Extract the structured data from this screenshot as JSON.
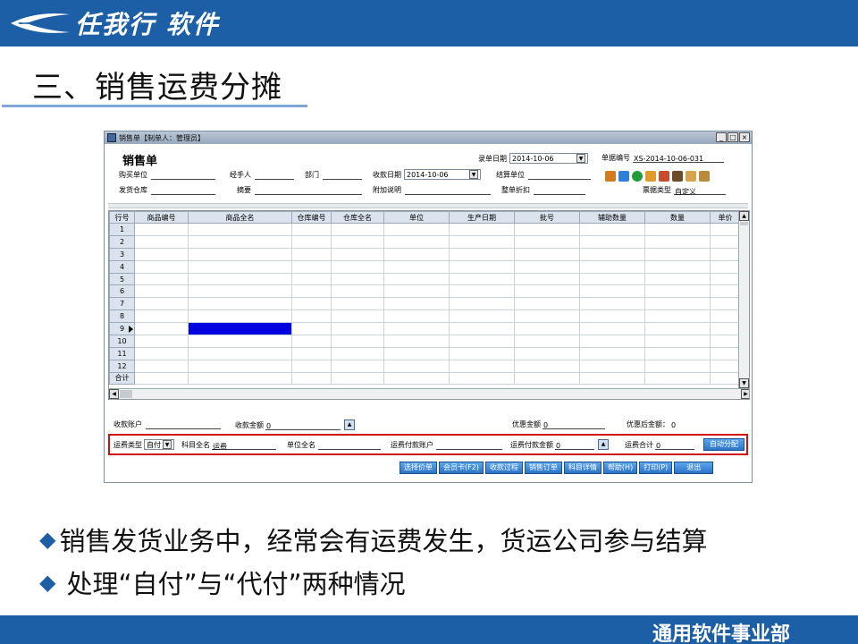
{
  "slide": {
    "logo_text": "任我行 软件",
    "title": "三、销售运费分摊",
    "bullets": [
      "销售发货业务中，经常会有运费发生，货运公司参与结算",
      "处理“自付”与“代付”两种情况"
    ],
    "footer": "通用软件事业部",
    "brand_color": "#1d5fa6"
  },
  "window": {
    "title": "销售单【制单人：管理员】",
    "controls": [
      "_",
      "□",
      "×"
    ],
    "form_title": "销售单",
    "entry_date_label": "录单日期",
    "entry_date": "2014-10-06",
    "doc_no_label": "单据编号",
    "doc_no": "XS-2014-10-06-031",
    "buyer_label": "购买单位",
    "handler_label": "经手人",
    "dept_label": "部门",
    "pay_date_label": "收款日期",
    "pay_date": "2014-10-06",
    "settle_label": "结算单位",
    "warehouse_label": "发货仓库",
    "summary_label": "摘要",
    "note_label": "附加说明",
    "discount_label": "整单折扣",
    "invoice_type_label": "票据类型",
    "invoice_type": "自定义"
  },
  "grid": {
    "columns": [
      "行号",
      "商品编号",
      "商品全名",
      "仓库编号",
      "仓库全名",
      "单位",
      "生产日期",
      "批号",
      "辅助数量",
      "数量",
      "单价"
    ],
    "rows": [
      "1",
      "2",
      "3",
      "4",
      "5",
      "6",
      "7",
      "8",
      "9",
      "10",
      "11",
      "12"
    ],
    "total_label": "合计"
  },
  "footer_fields": {
    "account_label": "收款账户",
    "amount_label": "收款金额",
    "amount": "0",
    "discount_amount_label": "优惠金额",
    "discount_amount": "0",
    "after_discount_label": "优惠后金额：",
    "after_discount": "0"
  },
  "freight": {
    "type_label": "运费类型",
    "type_value": "自付",
    "subject_label": "科目全名",
    "subject_value": "运费",
    "unit_label": "单位全名",
    "pay_account_label": "运费付款账户",
    "pay_amount_label": "运费付款金额",
    "pay_amount": "0",
    "total_label": "运费合计",
    "total": "0",
    "auto_button": "自动分配"
  },
  "buttons": [
    "选择价单",
    "会员卡(F2)",
    "收款过程",
    "销售订单",
    "科目详情",
    "帮助(H)",
    "打印(P)",
    "退出"
  ]
}
